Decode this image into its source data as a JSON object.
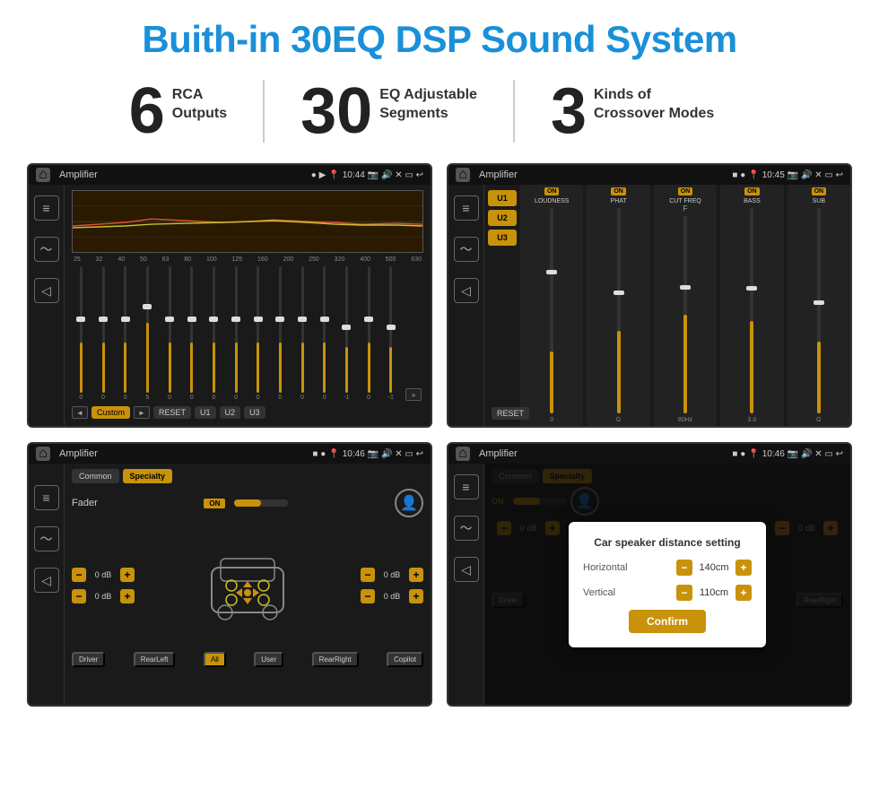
{
  "page": {
    "title": "Buith-in 30EQ DSP Sound System"
  },
  "stats": [
    {
      "number": "6",
      "label_line1": "RCA",
      "label_line2": "Outputs"
    },
    {
      "number": "30",
      "label_line1": "EQ Adjustable",
      "label_line2": "Segments"
    },
    {
      "number": "3",
      "label_line1": "Kinds of",
      "label_line2": "Crossover Modes"
    }
  ],
  "screens": {
    "eq": {
      "app_title": "Amplifier",
      "time": "10:44",
      "freq_labels": [
        "25",
        "32",
        "40",
        "50",
        "63",
        "80",
        "100",
        "125",
        "160",
        "200",
        "250",
        "320",
        "400",
        "500",
        "630"
      ],
      "slider_vals": [
        "0",
        "0",
        "0",
        "5",
        "0",
        "0",
        "0",
        "0",
        "0",
        "0",
        "0",
        "0",
        "-1",
        "0",
        "-1"
      ],
      "buttons": [
        "Custom",
        "RESET",
        "U1",
        "U2",
        "U3"
      ]
    },
    "crossover": {
      "app_title": "Amplifier",
      "time": "10:45",
      "presets": [
        "U1",
        "U2",
        "U3"
      ],
      "groups": [
        "LOUDNESS",
        "PHAT",
        "CUT FREQ",
        "BASS",
        "SUB"
      ],
      "reset_label": "RESET"
    },
    "fader": {
      "app_title": "Amplifier",
      "time": "10:46",
      "tabs": [
        "Common",
        "Specialty"
      ],
      "fader_label": "Fader",
      "on_label": "ON",
      "vol_items": [
        "0 dB",
        "0 dB",
        "0 dB",
        "0 dB"
      ],
      "bottom_btns": [
        "Driver",
        "RearLeft",
        "All",
        "User",
        "RearRight",
        "Copilot"
      ]
    },
    "dialog": {
      "app_title": "Amplifier",
      "time": "10:46",
      "tabs": [
        "Common",
        "Specialty"
      ],
      "on_label": "ON",
      "dialog_title": "Car speaker distance setting",
      "horizontal_label": "Horizontal",
      "horizontal_val": "140cm",
      "vertical_label": "Vertical",
      "vertical_val": "110cm",
      "confirm_label": "Confirm",
      "vol_items": [
        "0 dB",
        "0 dB"
      ]
    }
  }
}
